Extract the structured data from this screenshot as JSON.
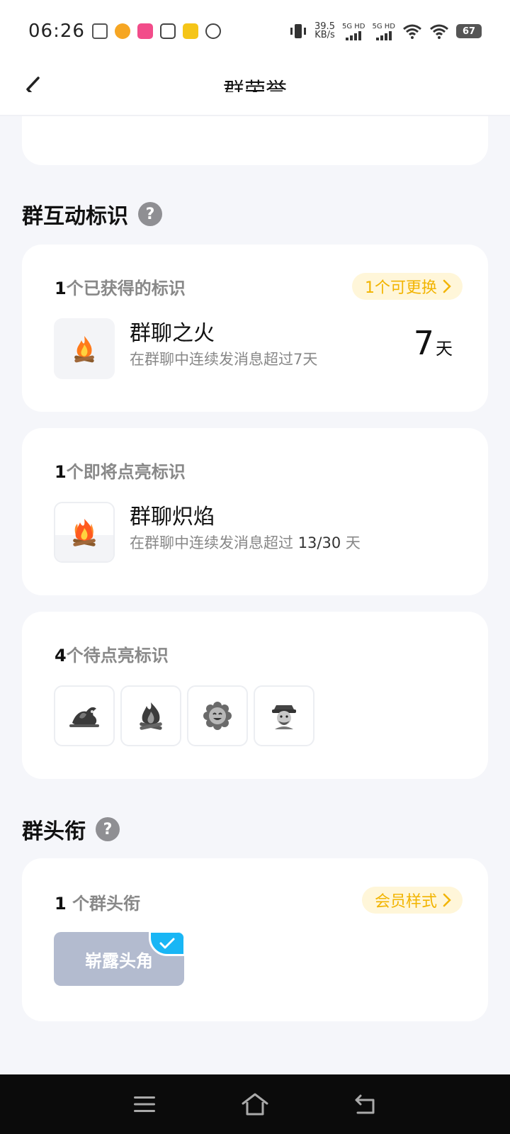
{
  "status": {
    "time": "06:26",
    "net_speed_value": "39.5",
    "net_speed_unit": "KB/s",
    "sim1_label": "5G HD",
    "sim2_label": "5G HD",
    "battery": "67"
  },
  "header": {
    "title": "群荣誉"
  },
  "interactive_section": {
    "title": "群互动标识",
    "help_glyph": "?",
    "obtained": {
      "count": "1",
      "label": "个已获得的标识",
      "replace_pill": "1个可更换",
      "badge": {
        "icon": "campfire-icon",
        "name": "群聊之火",
        "desc": "在群聊中连续发消息超过7天",
        "days_value": "7",
        "days_unit": "天"
      }
    },
    "upcoming": {
      "count": "1",
      "label": "个即将点亮标识",
      "badge": {
        "icon": "blazing-fire-icon",
        "name": "群聊炽焰",
        "desc_prefix": "在群聊中连续发消息超过",
        "progress": "13/30",
        "desc_suffix": "天"
      }
    },
    "pending": {
      "count": "4",
      "label": "个待点亮标识",
      "badges": [
        "dragon-fire-icon",
        "bonfire-icon",
        "smiling-flower-icon",
        "fortune-god-icon"
      ]
    }
  },
  "title_section": {
    "title": "群头衔",
    "help_glyph": "?",
    "card": {
      "count": "1",
      "label": "个群头衔",
      "member_pill": "会员样式",
      "chip": "崭露头角"
    }
  },
  "colors": {
    "accent_yellow": "#f2b400",
    "pill_bg": "#fff6d9",
    "check_blue": "#19b6f5",
    "chip_bg": "#b3bbcf"
  }
}
